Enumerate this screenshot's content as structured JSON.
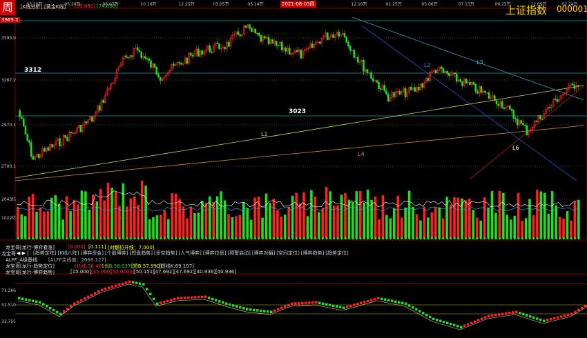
{
  "header": {
    "period_icon": "周",
    "indicator_label": "[K线分析]",
    "line_label": "[黄金K线]",
    "value_red": "[90.680]",
    "value_green": "[74.036]",
    "index_title": "上证指数",
    "index_code": "000001",
    "top_price": "3969.2",
    "highlight_date": "2021-08-03四"
  },
  "time_axis": [
    "03.20万",
    "05.29万",
    "08.07万",
    "10.16万",
    "12.25万",
    "03.05万",
    "05.14万",
    "07.23万",
    "",
    "12.10万",
    "02.25万",
    "05.06万",
    "07.15万",
    "09.23万",
    "12.09万",
    "02.24万"
  ],
  "price_axis": [
    "3593.9",
    "3267.2",
    "2970.1",
    "2700.1"
  ],
  "levels": {
    "l3312": "3312",
    "l3023": "3023"
  },
  "trend_labels": {
    "L1": "L1",
    "L2": "L2",
    "L3": "L3",
    "L4": "L4",
    "L6": "L6"
  },
  "volume_axis": [
    "2043亿",
    "1022亿"
  ],
  "row1": {
    "label": "龙宝哥[龙行-博弈看涨]",
    "v1": "[0.000]",
    "v2": "[0.111]",
    "v3": "[对翻拉开线：7.000]"
  },
  "row2": {
    "label": "龙宝哥",
    "tabs": [
      "[趋势定阵]",
      "[K线八阵]",
      "[博弈资金]",
      "[个股博弈]",
      "[短盘趋势]",
      "[多空趋势]",
      "[人气博弈]",
      "[博弈拉盘]",
      "[预警启动]",
      "[博弈对翻]",
      "[空间定位]",
      "[博弈趋势]",
      "[趋势定位]"
    ]
  },
  "row3": {
    "label": "ALFF_A级基线",
    "v1": "[ALFF主线值：2066.127]"
  },
  "row4": {
    "label": "龙宝哥[龙行-趋势定位]",
    "v1": "[长线:58.4653]",
    "v2": "[长B:58.037]",
    "v3": "[短B:57.990]",
    "v4": "[短线K:69.107]"
  },
  "row5": {
    "label": "龙宝哥[龙行-博弈趋势]",
    "v1": "[15.000]",
    "v2": "[45.000]",
    "v3": "[50.0000]",
    "v4": "[50.151]",
    "v5": "[47.692]",
    "v6": "[47.692]",
    "v7": "[40.936]",
    "v8": "[40.936]"
  },
  "osc_axis": [
    "71.266",
    "52.510",
    "33.755"
  ],
  "colors": {
    "up": "#ff2020",
    "down": "#22dd22",
    "level": "#00b0b0"
  }
}
